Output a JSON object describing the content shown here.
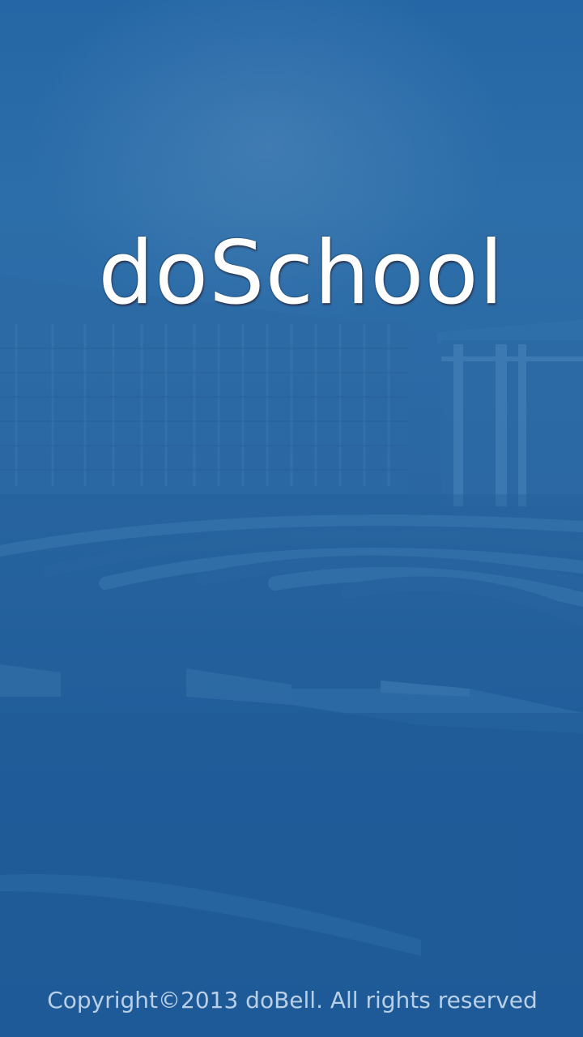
{
  "splash": {
    "app_title": "doSchool",
    "copyright": "Copyright©2013 doBell. All rights reserved"
  },
  "colors": {
    "background_top": "#2567a6",
    "background_bottom": "#1b5797",
    "title_text": "#ffffff",
    "copyright_text": "#b9cfe6"
  }
}
